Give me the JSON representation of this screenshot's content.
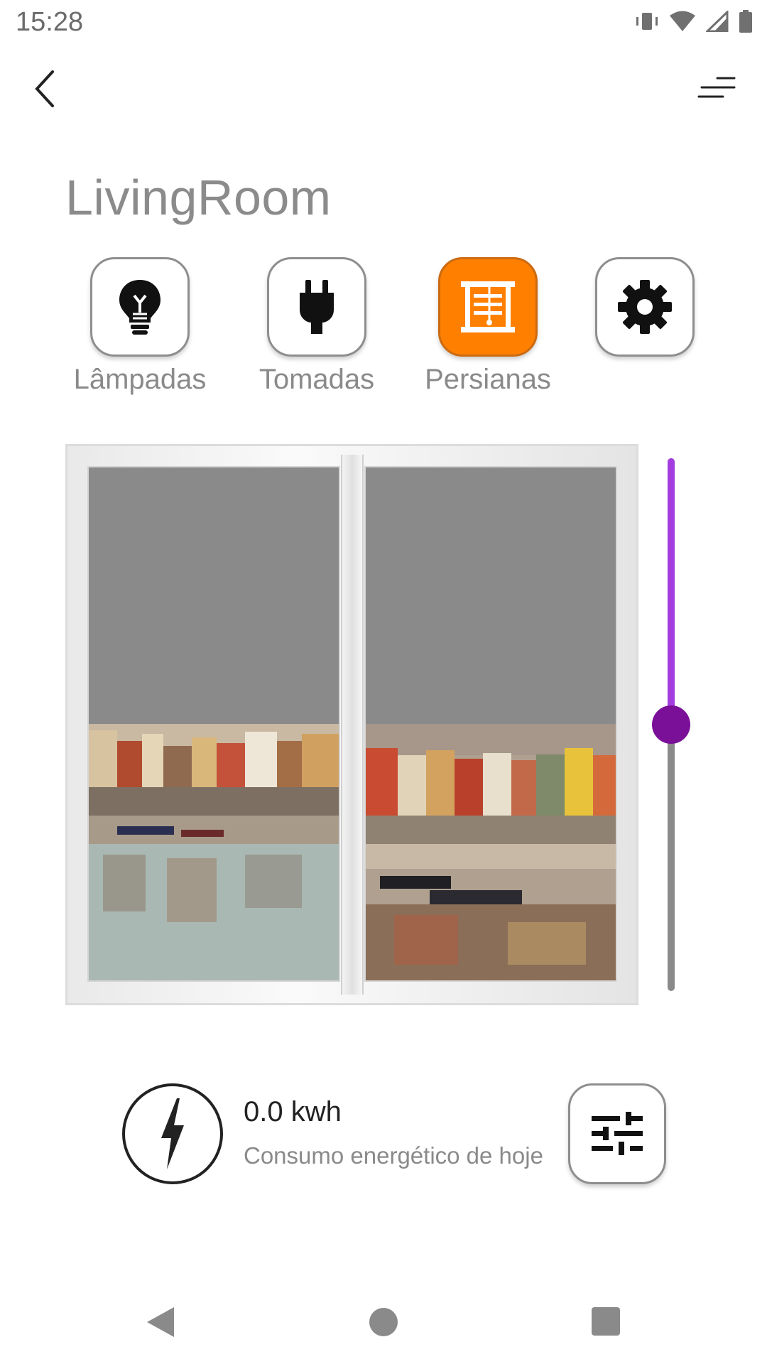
{
  "status_bar": {
    "time": "15:28",
    "icons": [
      "vibrate-icon",
      "wifi-icon",
      "cell-signal-icon",
      "battery-icon"
    ]
  },
  "header": {
    "back_icon": "chevron-left-icon",
    "menu_icon": "menu-lines-icon"
  },
  "room": {
    "title": "LivingRoom"
  },
  "categories": [
    {
      "label": "Lâmpadas",
      "icon": "lightbulb-icon",
      "active": false
    },
    {
      "label": "Tomadas",
      "icon": "plug-icon",
      "active": false
    },
    {
      "label": "Persianas",
      "icon": "blinds-icon",
      "active": true
    },
    {
      "label": "",
      "icon": "gear-icon",
      "active": false
    }
  ],
  "blinds": {
    "closed_fraction": 0.5,
    "slider_level": 0.5,
    "blind_color": "#8a8a8a",
    "slider_active_color": "#a33de0",
    "slider_thumb_color": "#7a0f98"
  },
  "energy": {
    "value": "0.0 kwh",
    "caption": "Consumo energético de hoje",
    "icon": "lightning-icon",
    "adjust_icon": "sliders-icon"
  },
  "colors": {
    "accent": "#ff8000"
  },
  "nav_bar": {
    "icons": [
      "nav-back-icon",
      "nav-home-icon",
      "nav-recent-icon"
    ]
  }
}
